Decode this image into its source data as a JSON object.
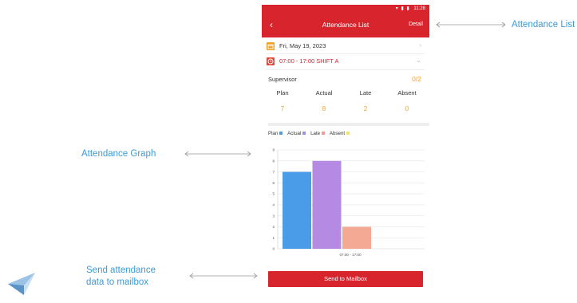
{
  "annotations": {
    "attendance_list": "Attendance List",
    "attendance_graph": "Attendance Graph",
    "send_line1": "Send attendance",
    "send_line2": "data to mailbox"
  },
  "status_bar": {
    "time": "11:28"
  },
  "header": {
    "title": "Attendance List",
    "detail": "Detail",
    "back_icon": "chevron-left-icon"
  },
  "date_row": {
    "text": "Fri, May 19, 2023",
    "icon": "calendar-icon",
    "icon_color": "#f0a22b"
  },
  "shift_row": {
    "text": "07:00 - 17:00  SHIFT A",
    "icon": "clock-icon",
    "icon_color": "#e0463c",
    "text_color": "#d8242c"
  },
  "supervisor": {
    "label": "Supervisor",
    "count": "0/2",
    "stats": [
      {
        "label": "Plan",
        "value": "7"
      },
      {
        "label": "Actual",
        "value": "8"
      },
      {
        "label": "Late",
        "value": "2"
      },
      {
        "label": "Absent",
        "value": "0"
      }
    ]
  },
  "chart_data": {
    "type": "bar",
    "categories": [
      "07:00 - 17:00"
    ],
    "series": [
      {
        "name": "Plan",
        "values": [
          7
        ],
        "color": "#4a9be8"
      },
      {
        "name": "Actual",
        "values": [
          8
        ],
        "color": "#b48ae3"
      },
      {
        "name": "Late",
        "values": [
          2
        ],
        "color": "#f4a994"
      },
      {
        "name": "Absent",
        "values": [
          0
        ],
        "color": "#f5e36b"
      }
    ],
    "yticks": [
      "0",
      "1",
      "2",
      "3",
      "4",
      "5",
      "6",
      "7",
      "8",
      "9"
    ],
    "ylim": [
      0,
      9
    ],
    "grid": true,
    "legend_position": "top-left",
    "legend_dot_colors": [
      "#4a9be8",
      "#9f8ee6",
      "#f29a9a",
      "#f3e26a"
    ]
  },
  "send_button": {
    "label": "Send to Mailbox",
    "color": "#d8242c"
  },
  "colors": {
    "brand_red": "#d8242c",
    "accent_orange": "#f0a22b",
    "annotation_blue": "#3a9bd8"
  }
}
